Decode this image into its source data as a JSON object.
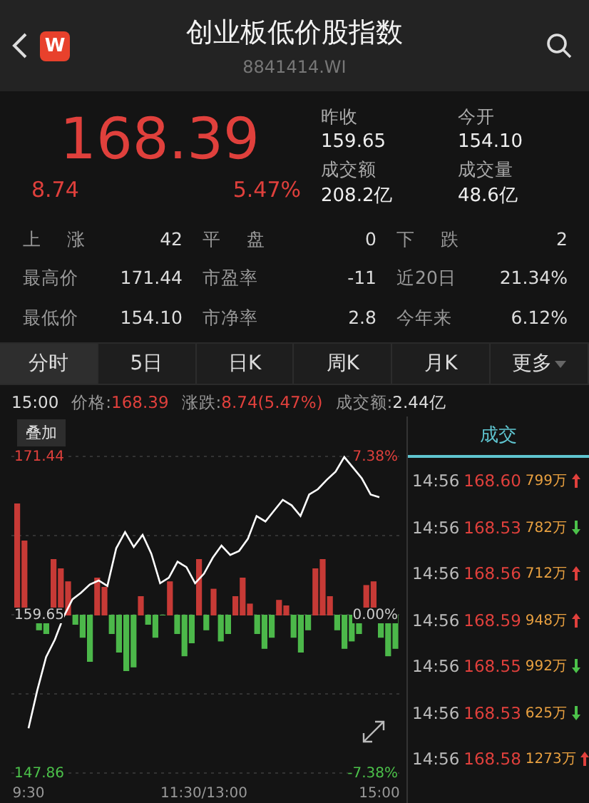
{
  "header": {
    "title": "创业板低价股指数",
    "code": "8841414.WI",
    "logo": "W"
  },
  "quote": {
    "price": "168.39",
    "change": "8.74",
    "change_pct": "5.47%"
  },
  "summary": [
    {
      "label": "昨收",
      "value": "159.65"
    },
    {
      "label": "今开",
      "value": "154.10"
    },
    {
      "label": "成交额",
      "value": "208.2亿"
    },
    {
      "label": "成交量",
      "value": "48.6亿"
    }
  ],
  "stats": [
    [
      {
        "label": "上 涨",
        "value": "42"
      },
      {
        "label": "平 盘",
        "value": "0"
      },
      {
        "label": "下 跌",
        "value": "2"
      }
    ],
    [
      {
        "label": "最高价",
        "value": "171.44"
      },
      {
        "label": "市盈率",
        "value": "-11"
      },
      {
        "label": "近20日",
        "value": "21.34%"
      }
    ],
    [
      {
        "label": "最低价",
        "value": "154.10"
      },
      {
        "label": "市净率",
        "value": "2.8"
      },
      {
        "label": "今年来",
        "value": "6.12%"
      }
    ]
  ],
  "tabs": [
    {
      "label": "分时",
      "selected": true
    },
    {
      "label": "5日",
      "selected": false
    },
    {
      "label": "日K",
      "selected": false
    },
    {
      "label": "周K",
      "selected": false
    },
    {
      "label": "月K",
      "selected": false
    },
    {
      "label": "更多",
      "selected": false
    }
  ],
  "info": {
    "time": "15:00",
    "price_label": "价格:",
    "price": "168.39",
    "change_label": "涨跌:",
    "change": "8.74(5.47%)",
    "amount_label": "成交额:",
    "amount": "2.44亿"
  },
  "chart": {
    "chart_data": {
      "type": "line",
      "ylim": [
        147.86,
        171.44
      ],
      "yticks": [
        147.86,
        159.65,
        171.44
      ],
      "categories": [
        "9:30",
        null,
        null,
        null,
        null,
        null,
        null,
        null,
        null,
        null,
        null,
        null,
        null,
        null,
        null,
        null,
        null,
        null,
        null,
        null,
        "11:30/13:00",
        null,
        null,
        null,
        null,
        null,
        null,
        null,
        null,
        null,
        null,
        null,
        null,
        null,
        null,
        null,
        null,
        null,
        null,
        null,
        "15:00"
      ],
      "series": [
        {
          "color": "#ffffff",
          "values": [
            151.2,
            154.0,
            156.5,
            157.8,
            159.5,
            160.8,
            161.3,
            161.9,
            162.2,
            161.8,
            164.6,
            165.8,
            164.7,
            165.6,
            164.2,
            162.0,
            162.4,
            163.6,
            163.2,
            162.0,
            162.7,
            163.9,
            164.8,
            164.1,
            164.4,
            165.3,
            167.0,
            166.6,
            167.4,
            168.2,
            167.8,
            167.0,
            168.6,
            169.0,
            169.7,
            170.3,
            171.4,
            170.6,
            169.8,
            168.6,
            168.4
          ]
        }
      ]
    },
    "overlay_button": "叠加",
    "high_pct": "7.38%",
    "mid_pct": "0.00%",
    "low_pct": "-7.38%"
  },
  "trades": {
    "title": "成交",
    "rows": [
      {
        "time": "14:56",
        "price": "168.60",
        "volume": "799万",
        "up": true
      },
      {
        "time": "14:56",
        "price": "168.53",
        "volume": "782万",
        "up": false
      },
      {
        "time": "14:56",
        "price": "168.56",
        "volume": "712万",
        "up": true
      },
      {
        "time": "14:56",
        "price": "168.59",
        "volume": "948万",
        "up": true
      },
      {
        "time": "14:56",
        "price": "168.55",
        "volume": "992万",
        "up": false
      },
      {
        "time": "14:56",
        "price": "168.53",
        "volume": "625万",
        "up": false
      },
      {
        "time": "14:56",
        "price": "168.58",
        "volume": "1273万",
        "up": true
      }
    ]
  }
}
